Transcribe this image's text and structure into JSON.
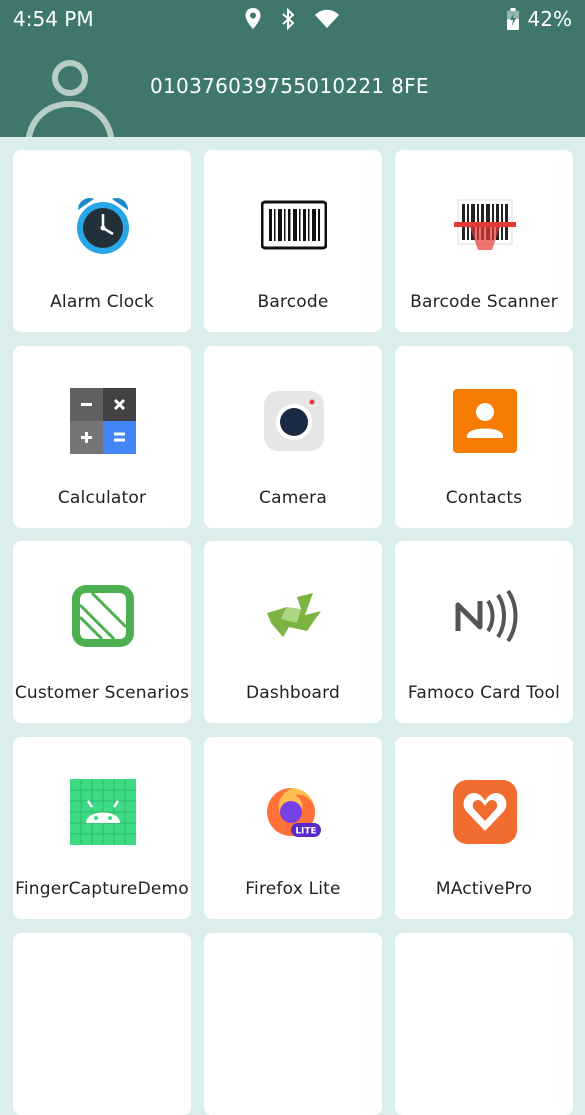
{
  "status_bar": {
    "time": "4:54 PM",
    "battery": "42%",
    "icons": [
      "location-icon",
      "bluetooth-icon",
      "wifi-icon",
      "battery-charging-icon"
    ]
  },
  "header": {
    "user_id": "010376039755010221 8FE"
  },
  "apps": [
    {
      "label": "Alarm Clock",
      "icon": "alarm-clock-icon"
    },
    {
      "label": "Barcode",
      "icon": "barcode-icon"
    },
    {
      "label": "Barcode Scanner",
      "icon": "barcode-scanner-icon"
    },
    {
      "label": "Calculator",
      "icon": "calculator-icon"
    },
    {
      "label": "Camera",
      "icon": "camera-icon"
    },
    {
      "label": "Contacts",
      "icon": "contacts-icon"
    },
    {
      "label": "Customer Scenarios",
      "icon": "customer-scenarios-icon"
    },
    {
      "label": "Dashboard",
      "icon": "dashboard-icon"
    },
    {
      "label": "Famoco Card Tool",
      "icon": "nfc-icon"
    },
    {
      "label": "FingerCaptureDemo",
      "icon": "android-icon"
    },
    {
      "label": "Firefox Lite",
      "icon": "firefox-lite-icon"
    },
    {
      "label": "MActivePro",
      "icon": "mactivepro-icon"
    }
  ],
  "colors": {
    "header": "#3f776f",
    "background": "#dceeec",
    "tile": "#ffffff"
  }
}
